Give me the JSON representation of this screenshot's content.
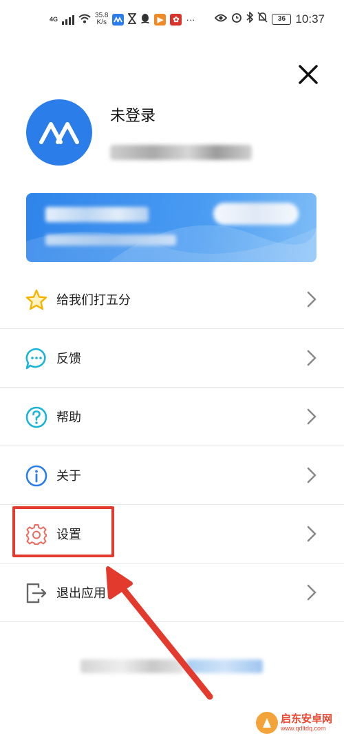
{
  "status_bar": {
    "network": "4G",
    "speed_value": "35.8",
    "speed_unit": "K/s",
    "battery": "36",
    "time": "10:37"
  },
  "profile": {
    "username": "未登录"
  },
  "menu": [
    {
      "label": "给我们打五分",
      "icon": "star-icon",
      "color": "#f4b400"
    },
    {
      "label": "反馈",
      "icon": "chat-bubble-icon",
      "color": "#1ab5d6"
    },
    {
      "label": "帮助",
      "icon": "question-circle-icon",
      "color": "#1ab5d6"
    },
    {
      "label": "关于",
      "icon": "info-circle-icon",
      "color": "#2b7de9"
    },
    {
      "label": "设置",
      "icon": "gear-icon",
      "color": "#e86b5f"
    },
    {
      "label": "退出应用",
      "icon": "exit-icon",
      "color": "#666666"
    }
  ],
  "colors": {
    "accent": "#2b7de9",
    "highlight": "#e23b2e"
  },
  "watermark": {
    "title": "启东安卓网",
    "url": "www.qdltdq.com"
  }
}
